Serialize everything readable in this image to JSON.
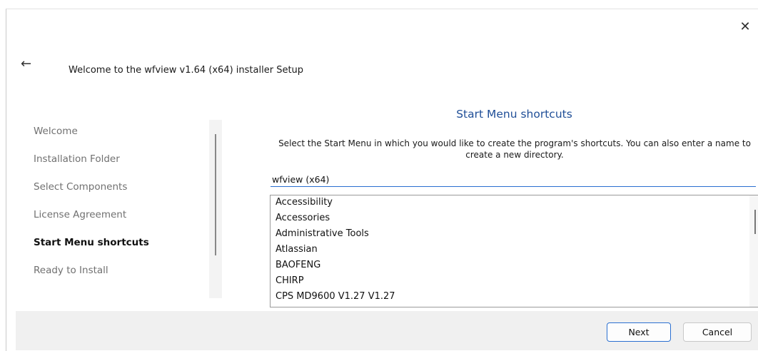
{
  "window": {
    "title": "Welcome to the wfview v1.64 (x64) installer Setup",
    "close_glyph": "✕",
    "back_glyph": "←",
    "close_icon": "close-icon",
    "back_icon": "back-arrow-icon"
  },
  "sidebar": {
    "steps": [
      {
        "label": "Welcome",
        "active": false
      },
      {
        "label": "Installation Folder",
        "active": false
      },
      {
        "label": "Select Components",
        "active": false
      },
      {
        "label": "License Agreement",
        "active": false
      },
      {
        "label": "Start Menu shortcuts",
        "active": true
      },
      {
        "label": "Ready to Install",
        "active": false
      }
    ]
  },
  "page": {
    "heading": "Start Menu shortcuts",
    "description": "Select the Start Menu in which you would like to create the program's shortcuts. You can also enter a name to create a new directory.",
    "folder_name_value": "wfview (x64)",
    "folders": [
      "Accessibility",
      "Accessories",
      "Administrative Tools",
      "Atlassian",
      "BAOFENG",
      "CHIRP",
      "CPS MD9600 V1.27 V1.27"
    ]
  },
  "footer": {
    "next_label": "Next",
    "cancel_label": "Cancel"
  },
  "colors": {
    "heading": "#1f4e97",
    "accent": "#2a6fd0",
    "footer_bg": "#f0f0f0"
  }
}
